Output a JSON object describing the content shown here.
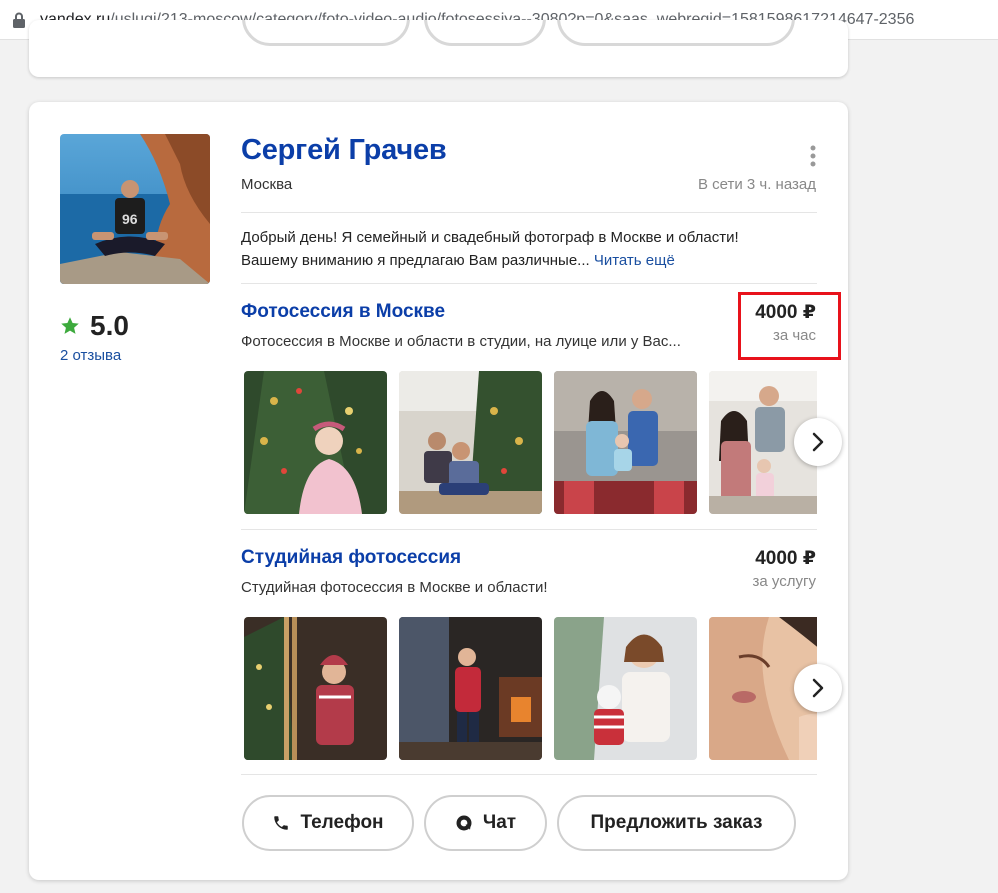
{
  "browser": {
    "url_host": "yandex.ru",
    "url_path": "/uslugi/213-moscow/category/foto-video-audio/fotosessiya--3080?p=0&saas_webreqid=1581598617214647-2356"
  },
  "profile": {
    "name": "Сергей Грачев",
    "city": "Москва",
    "online_status": "В сети 3 ч. назад",
    "rating": "5.0",
    "reviews_label": "2 отзыва",
    "description_line1": "Добрый день! Я семейный и свадебный фотограф в Москве и области!",
    "description_line2": "Вашему вниманию я предлагаю Вам различные...",
    "read_more": "Читать ещё"
  },
  "services": [
    {
      "title": "Фотосессия в Москве",
      "subtitle": "Фотосессия в Москве и области в студии, на луице или у Вас...",
      "price": "4000 ₽",
      "unit": "за час"
    },
    {
      "title": "Студийная фотосессия",
      "subtitle": "Студийная фотосессия в Москве и области!",
      "price": "4000 ₽",
      "unit": "за услугу"
    }
  ],
  "actions": {
    "phone": "Телефон",
    "chat": "Чат",
    "order": "Предложить заказ"
  },
  "colors": {
    "link": "#0b3ea8",
    "star": "#3daa3d",
    "highlight": "#e8121b"
  }
}
